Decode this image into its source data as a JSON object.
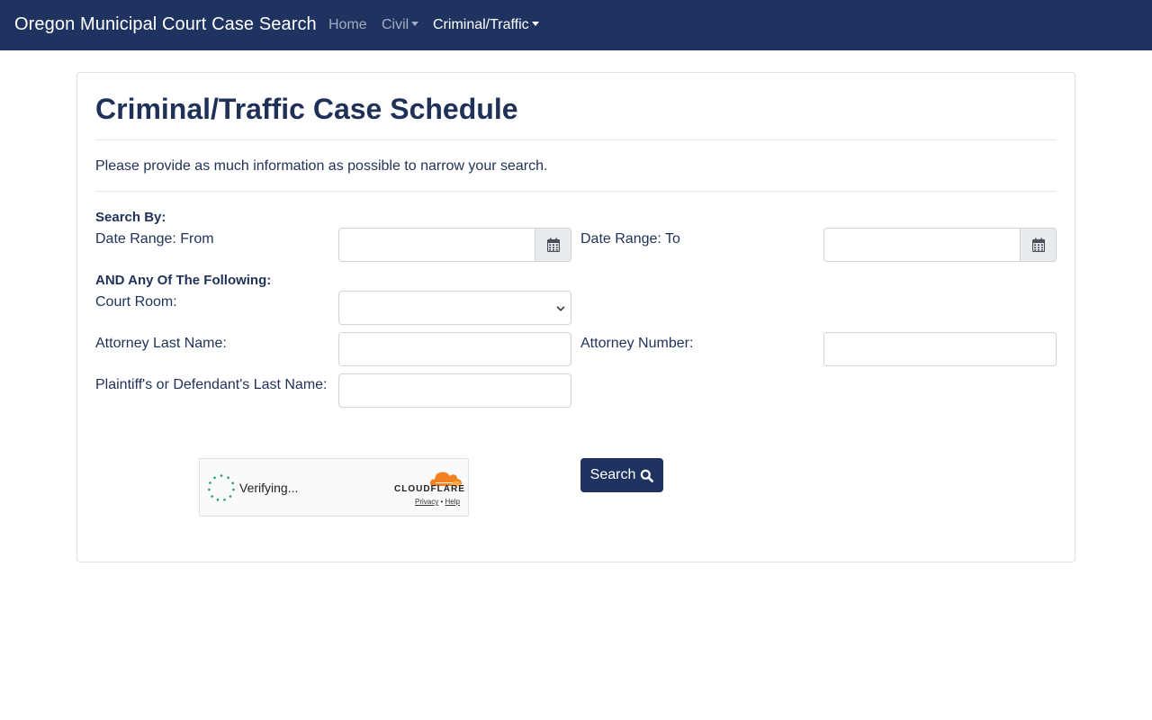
{
  "navbar": {
    "brand": "Oregon Municipal Court Case Search",
    "items": [
      {
        "label": "Home"
      },
      {
        "label": "Civil"
      },
      {
        "label": "Criminal/Traffic"
      }
    ],
    "background": "#1f3360"
  },
  "page": {
    "title": "Criminal/Traffic Case Schedule",
    "intro": "Please provide as much information as possible to narrow your search."
  },
  "form": {
    "search_by_label": "Search By:",
    "date_from_label": "Date Range: From",
    "date_from_value": "",
    "date_to_label": "Date Range: To",
    "date_to_value": "",
    "and_any_label": "AND Any Of The Following:",
    "court_room_label": "Court Room:",
    "court_room_selected": "",
    "attorney_last_name_label": "Attorney Last Name:",
    "attorney_last_name_value": "",
    "attorney_number_label": "Attorney Number:",
    "attorney_number_value": "",
    "party_last_name_label": "Plaintiff's or Defendant's Last Name:",
    "party_last_name_value": "",
    "search_button_label": "Search"
  },
  "captcha": {
    "status": "Verifying...",
    "provider": "CLOUDFLARE",
    "privacy_link": "Privacy",
    "separator": "•",
    "help_link": "Help"
  },
  "icons": {
    "date_picker": "calendar-icon",
    "search": "search-icon",
    "select": "chevron-down-icon"
  }
}
